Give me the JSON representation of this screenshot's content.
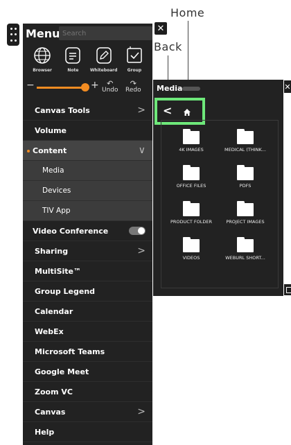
{
  "annotations": {
    "home": "Home",
    "back": "Back"
  },
  "menu": {
    "title": "Menu",
    "search_placeholder": "Search",
    "tools": [
      {
        "label": "Browser",
        "icon": "globe-icon"
      },
      {
        "label": "Note",
        "icon": "note-icon"
      },
      {
        "label": "Whiteboard",
        "icon": "pencil-icon"
      },
      {
        "label": "Group",
        "icon": "group-icon"
      }
    ],
    "volume_controls": {
      "minus": "−",
      "plus": "+",
      "undo": "Undo",
      "redo": "Redo",
      "volume_level": 0.9
    },
    "items": [
      {
        "label": "Canvas Tools",
        "chevron": ">"
      },
      {
        "label": "Volume"
      },
      {
        "label": "Content",
        "chevron": "∨",
        "expanded": true,
        "children": [
          "Media",
          "Devices",
          "TIV App"
        ]
      },
      {
        "label": "Video Conference",
        "toggle": "off"
      },
      {
        "label": "Sharing",
        "chevron": ">"
      },
      {
        "label": "MultiSite™"
      },
      {
        "label": "Group Legend"
      },
      {
        "label": "Calendar"
      },
      {
        "label": "WebEx"
      },
      {
        "label": "Microsoft Teams"
      },
      {
        "label": "Google Meet"
      },
      {
        "label": "Zoom VC"
      },
      {
        "label": "Canvas",
        "chevron": ">"
      },
      {
        "label": "Help"
      }
    ]
  },
  "media": {
    "title": "Media",
    "folders": [
      "4K IMAGES",
      "MEDICAL (THINK...",
      "OFFICE FILES",
      "PDFS",
      "PRODUCT FOLDER",
      "PROJECT IMAGES",
      "VIDEOS",
      "WEBURL SHORT..."
    ]
  },
  "colors": {
    "accent": "#f28c22",
    "panel": "#222222",
    "highlight": "#6ee87a"
  }
}
